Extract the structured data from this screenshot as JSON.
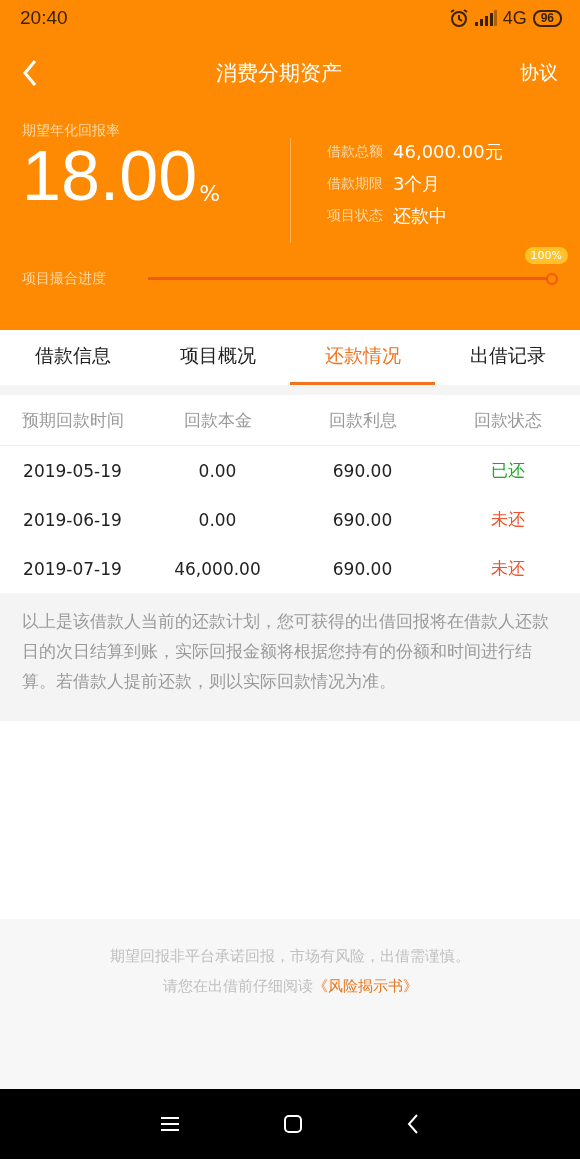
{
  "status_bar": {
    "time": "20:40",
    "network": "4G",
    "battery": "96"
  },
  "nav": {
    "title": "消费分期资产",
    "action": "协议"
  },
  "hero": {
    "rate_label": "期望年化回报率",
    "rate": "18.00",
    "rate_unit": "%",
    "facts": [
      {
        "label": "借款总额",
        "value": "46,000.00元"
      },
      {
        "label": "借款期限",
        "value": "3个月"
      },
      {
        "label": "项目状态",
        "value": "还款中"
      }
    ],
    "progress": {
      "label": "项目撮合进度",
      "level": 1,
      "reading": "100%"
    }
  },
  "tabs": [
    {
      "label": "借款信息",
      "selected": false
    },
    {
      "label": "项目概况",
      "selected": false
    },
    {
      "label": "还款情况",
      "selected": true
    },
    {
      "label": "出借记录",
      "selected": false
    }
  ],
  "table": {
    "columns": [
      "预期回款时间",
      "回款本金",
      "回款利息",
      "回款状态"
    ],
    "rows": [
      {
        "date": "2019-05-19",
        "principal": "0.00",
        "interest": "690.00",
        "status": "已还",
        "paid": true
      },
      {
        "date": "2019-06-19",
        "principal": "0.00",
        "interest": "690.00",
        "status": "未还",
        "paid": false
      },
      {
        "date": "2019-07-19",
        "principal": "46,000.00",
        "interest": "690.00",
        "status": "未还",
        "paid": false
      }
    ]
  },
  "note": "以上是该借款人当前的还款计划，您可获得的出借回报将在借款人还款日的次日结算到账，实际回报金额将根据您持有的份额和时间进行结算。若借款人提前还款，则以实际回款情况为准。",
  "footer": {
    "line1": "期望回报非平台承诺回报，市场有风险，出借需谨慎。",
    "line2": "请您在出借前仔细阅读",
    "link": "《风险揭示书》"
  }
}
